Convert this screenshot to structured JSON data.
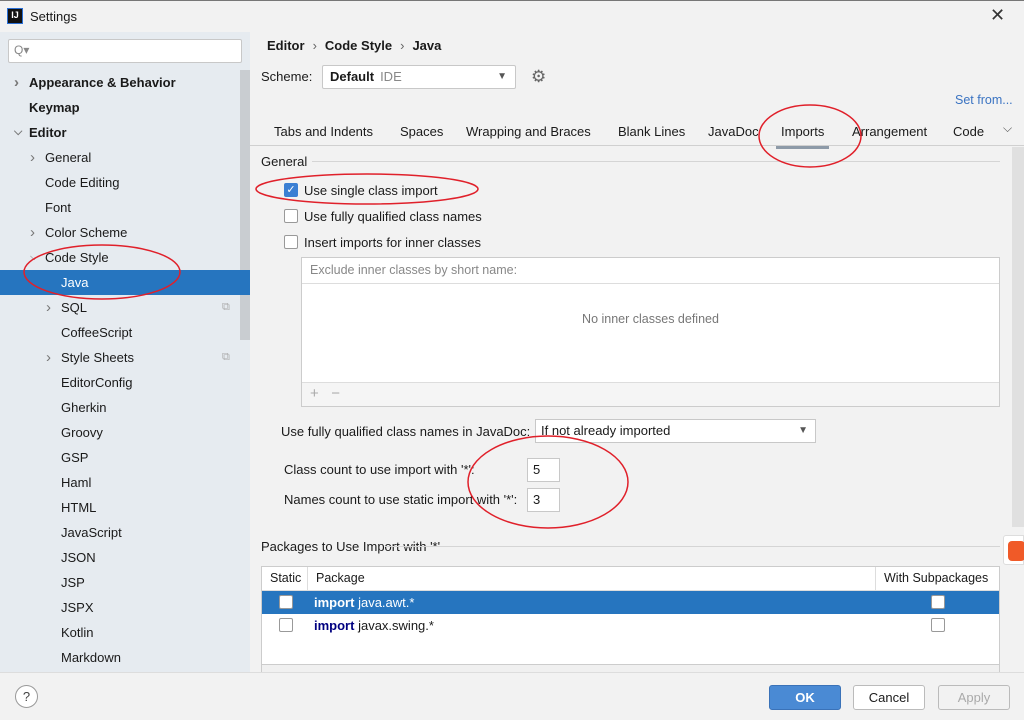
{
  "window": {
    "title": "Settings",
    "app_icon": "IJ"
  },
  "sidebar": {
    "search_placeholder": "Q▾",
    "items": [
      {
        "label": "Appearance & Behavior",
        "expandable": true,
        "expanded": false
      },
      {
        "label": "Keymap"
      },
      {
        "label": "Editor",
        "expandable": true,
        "expanded": true
      },
      {
        "label": "General",
        "expandable": true
      },
      {
        "label": "Code Editing"
      },
      {
        "label": "Font"
      },
      {
        "label": "Color Scheme",
        "expandable": true
      },
      {
        "label": "Code Style",
        "expandable": true,
        "expanded": true
      },
      {
        "label": "Java",
        "selected": true
      },
      {
        "label": "SQL",
        "expandable": true,
        "copy_icon": true
      },
      {
        "label": "CoffeeScript"
      },
      {
        "label": "Style Sheets",
        "expandable": true,
        "copy_icon": true
      },
      {
        "label": "EditorConfig"
      },
      {
        "label": "Gherkin"
      },
      {
        "label": "Groovy"
      },
      {
        "label": "GSP"
      },
      {
        "label": "Haml"
      },
      {
        "label": "HTML"
      },
      {
        "label": "JavaScript"
      },
      {
        "label": "JSON"
      },
      {
        "label": "JSP"
      },
      {
        "label": "JSPX"
      },
      {
        "label": "Kotlin"
      },
      {
        "label": "Markdown"
      }
    ]
  },
  "breadcrumb": [
    "Editor",
    "Code Style",
    "Java"
  ],
  "breadcrumb_sep": "›",
  "scheme": {
    "label": "Scheme:",
    "value": "Default",
    "sub": "IDE"
  },
  "set_from": "Set from...",
  "tabs": [
    "Tabs and Indents",
    "Spaces",
    "Wrapping and Braces",
    "Blank Lines",
    "JavaDoc",
    "Imports",
    "Arrangement",
    "Code"
  ],
  "active_tab": "Imports",
  "general": {
    "title": "General",
    "options": [
      {
        "label": "Use single class import",
        "checked": true
      },
      {
        "label": "Use fully qualified class names",
        "checked": false
      },
      {
        "label": "Insert imports for inner classes",
        "checked": false
      }
    ],
    "exclude_placeholder": "Exclude inner classes by short name:",
    "exclude_empty": "No inner classes defined",
    "add": "+",
    "remove": "−",
    "javadoc_label": "Use fully qualified class names in JavaDoc:",
    "javadoc_value": "If not already imported",
    "class_count_label": "Class count to use import with '*':",
    "class_count": "5",
    "names_count_label": "Names count to use static import with '*':",
    "names_count": "3"
  },
  "packages": {
    "title": "Packages to Use Import with '*'",
    "columns": [
      "Static",
      "Package",
      "With Subpackages"
    ],
    "rows": [
      {
        "static": false,
        "keyword": "import",
        "package": "java.awt.*",
        "subpackages": false,
        "selected": true
      },
      {
        "static": false,
        "keyword": "import",
        "package": "javax.swing.*",
        "subpackages": false
      }
    ]
  },
  "footer": {
    "help": "?",
    "ok": "OK",
    "cancel": "Cancel",
    "apply": "Apply"
  },
  "colors": {
    "selection": "#2675bf",
    "annotation": "#e0202a",
    "link": "#3a73c2"
  }
}
